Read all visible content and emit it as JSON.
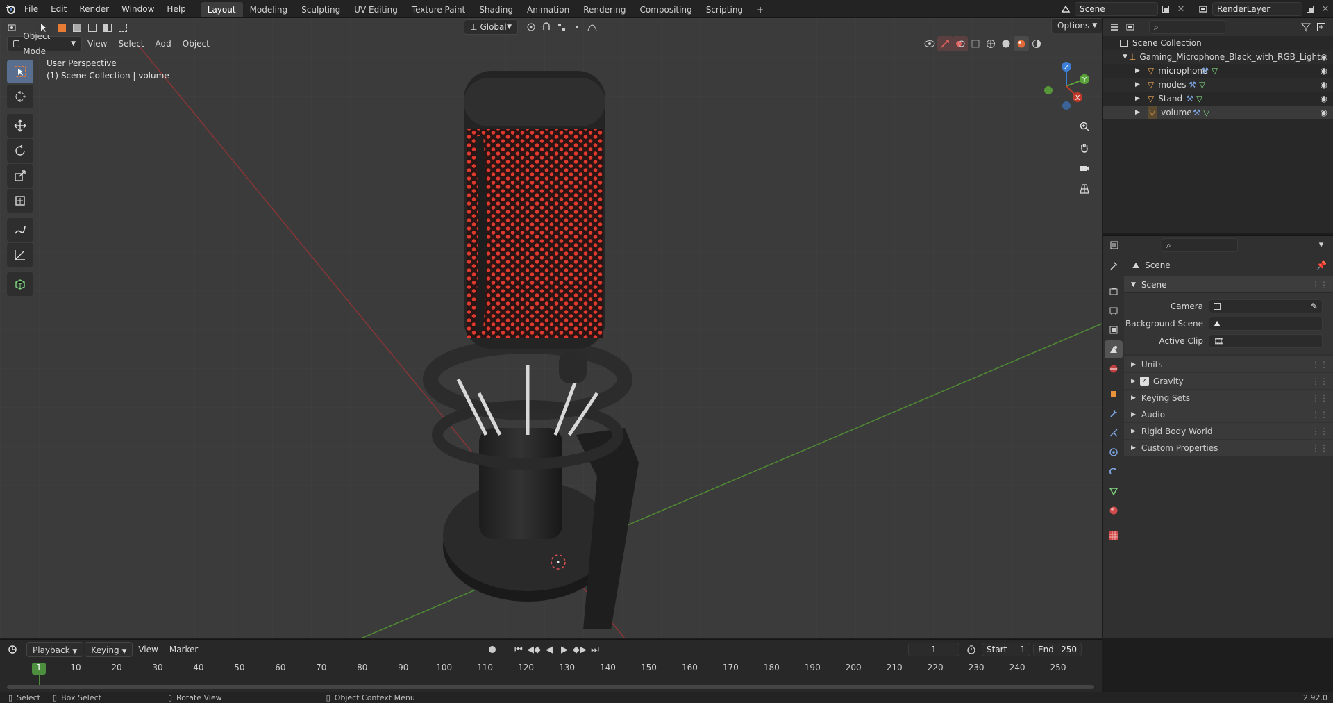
{
  "topbar": {
    "menus": [
      "File",
      "Edit",
      "Render",
      "Window",
      "Help"
    ],
    "workspaces": [
      "Layout",
      "Modeling",
      "Sculpting",
      "UV Editing",
      "Texture Paint",
      "Shading",
      "Animation",
      "Rendering",
      "Compositing",
      "Scripting"
    ],
    "active_workspace": "Layout",
    "add_tab": "+",
    "scene_name": "Scene",
    "view_layer": "RenderLayer"
  },
  "viewport": {
    "mode": "Object Mode",
    "menus": [
      "View",
      "Select",
      "Add",
      "Object"
    ],
    "transform_orientation": "Global",
    "options_label": "Options",
    "overlay_title": "User Perspective",
    "overlay_subtitle": "(1) Scene Collection | volume",
    "gizmo": {
      "z": "Z",
      "y": "Y",
      "x": "X"
    }
  },
  "outliner": {
    "root": "Scene Collection",
    "collection": "Gaming_Microphone_Black_with_RGB_Light",
    "objects": [
      "microphone",
      "modes",
      "Stand",
      "volume"
    ]
  },
  "properties": {
    "context": "Scene",
    "panel": "Scene",
    "fields": [
      {
        "label": "Camera",
        "value": ""
      },
      {
        "label": "Background Scene",
        "value": ""
      },
      {
        "label": "Active Clip",
        "value": ""
      }
    ],
    "subpanels": [
      "Units",
      "Gravity",
      "Keying Sets",
      "Audio",
      "Rigid Body World",
      "Custom Properties"
    ]
  },
  "timeline": {
    "menus": [
      "Playback",
      "Keying",
      "View",
      "Marker"
    ],
    "current_frame": "1",
    "start_label": "Start",
    "start": "1",
    "end_label": "End",
    "end": "250",
    "ticks": [
      "1",
      "10",
      "20",
      "30",
      "40",
      "50",
      "60",
      "70",
      "80",
      "90",
      "100",
      "110",
      "120",
      "130",
      "140",
      "150",
      "160",
      "170",
      "180",
      "190",
      "200",
      "210",
      "220",
      "230",
      "240",
      "250"
    ]
  },
  "statusbar": {
    "select": "Select",
    "box_select": "Box Select",
    "rotate": "Rotate View",
    "context_menu": "Object Context Menu",
    "version": "2.92.0"
  },
  "colors": {
    "accent": "#4772b3",
    "mic_glow": "#e03a2e",
    "axis_x": "#c0392b",
    "axis_y": "#5aa33a",
    "axis_z": "#3c7fd6"
  }
}
